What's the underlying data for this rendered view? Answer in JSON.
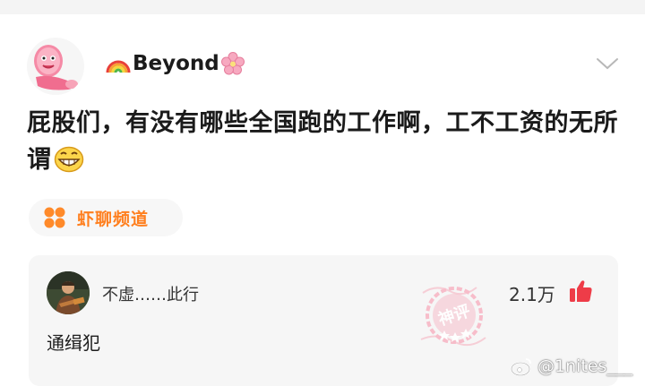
{
  "post": {
    "username": "Beyond",
    "text": "屁股们，有没有哪些全国跑的工作啊，工不工资的无所谓",
    "channel": "虾聊频道"
  },
  "comment": {
    "username": "不虚……此行",
    "text": "通缉犯",
    "likes": "2.1万",
    "stamp_text": "神评"
  },
  "watermark": "@1nites___",
  "colors": {
    "accent_orange": "#ff7f1e",
    "like_red": "#ee3c48",
    "stamp_pink": "#f7a3b4"
  },
  "icons": {
    "chevron": "chevron-down-icon",
    "like": "thumbs-up-icon",
    "channel": "channel-flower-icon",
    "rainbow": "rainbow-emoji",
    "sakura": "cherry-blossom-emoji",
    "grin": "grinning-emoji"
  }
}
